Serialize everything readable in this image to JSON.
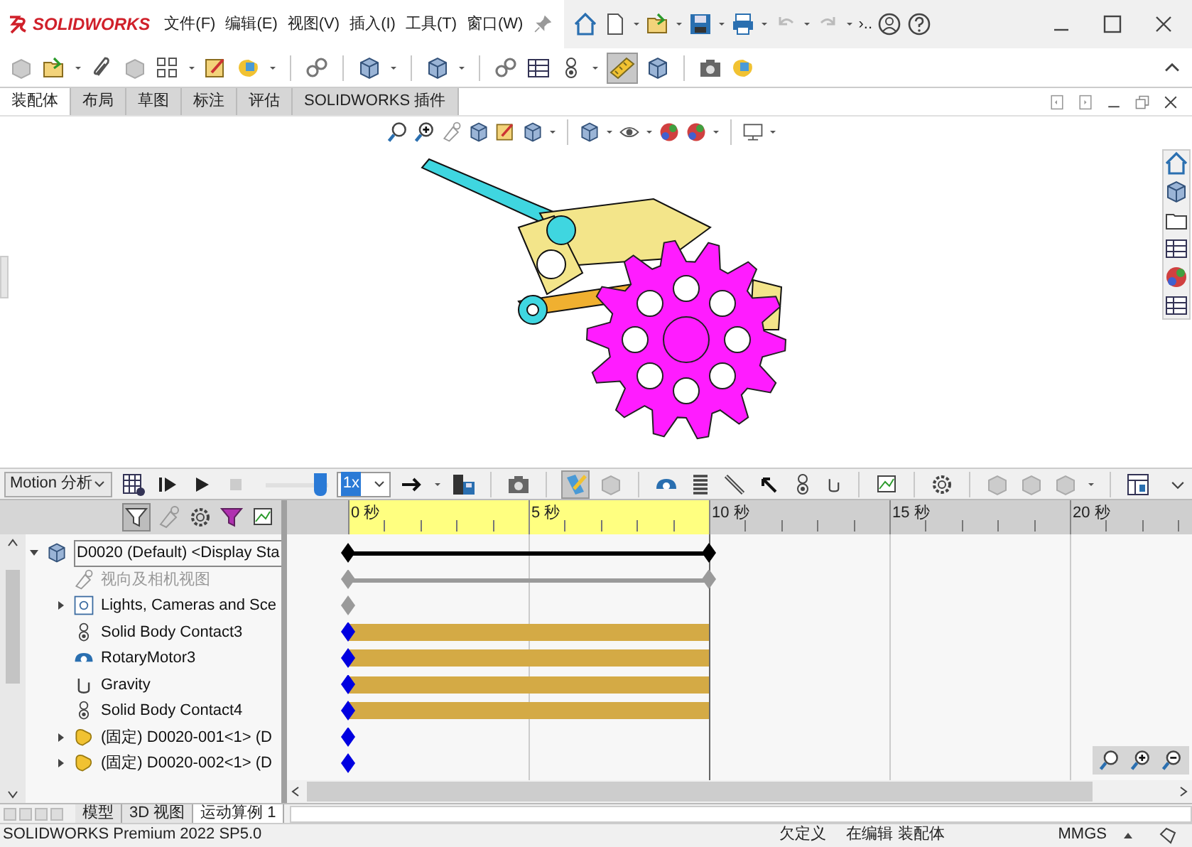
{
  "app": {
    "logo": "SOLIDWORKS",
    "menus": [
      "文件(F)",
      "编辑(E)",
      "视图(V)",
      "插入(I)",
      "工具(T)",
      "窗口(W)"
    ],
    "overflow": "›.."
  },
  "command_tabs": [
    {
      "label": "装配体",
      "selected": true
    },
    {
      "label": "布局",
      "selected": false
    },
    {
      "label": "草图",
      "selected": false
    },
    {
      "label": "标注",
      "selected": false
    },
    {
      "label": "评估",
      "selected": false
    },
    {
      "label": "SOLIDWORKS 插件",
      "selected": false
    }
  ],
  "motion_toolbar": {
    "study_type": "Motion 分析",
    "playback": {
      "level": 0.96
    },
    "speed": "1x"
  },
  "tree": [
    {
      "label": "D0020 (Default) <Display Sta",
      "kind": "assembly",
      "expanded": true,
      "disabled": false
    },
    {
      "label": "视向及相机视图",
      "kind": "camera",
      "disabled": true
    },
    {
      "label": "Lights, Cameras and Sce",
      "kind": "scene",
      "expanded": false,
      "disabled": false
    },
    {
      "label": "Solid Body Contact3",
      "kind": "contact",
      "disabled": false
    },
    {
      "label": "RotaryMotor3",
      "kind": "motor",
      "disabled": false
    },
    {
      "label": "Gravity",
      "kind": "gravity",
      "disabled": false
    },
    {
      "label": "Solid Body Contact4",
      "kind": "contact",
      "disabled": false
    },
    {
      "label": "(固定) D0020-001<1> (D",
      "kind": "part",
      "expanded": false,
      "disabled": false
    },
    {
      "label": "(固定) D0020-002<1> (D",
      "kind": "part",
      "expanded": false,
      "disabled": false
    }
  ],
  "timeline": {
    "ticks": [
      {
        "label": "0 秒",
        "in_range": true
      },
      {
        "label": "5 秒",
        "in_range": true
      },
      {
        "label": "10 秒",
        "in_range": false
      },
      {
        "label": "15 秒",
        "in_range": false
      },
      {
        "label": "20 秒",
        "in_range": false
      }
    ],
    "rows": [
      {
        "kind": "line",
        "color": "#000000"
      },
      {
        "kind": "line",
        "color": "#9a9a9a"
      },
      {
        "kind": "key",
        "color": "#9a9a9a"
      },
      {
        "kind": "bar",
        "color": "#0000e0"
      },
      {
        "kind": "bar",
        "color": "#0000e0"
      },
      {
        "kind": "bar",
        "color": "#0000e0"
      },
      {
        "kind": "bar",
        "color": "#0000e0"
      },
      {
        "kind": "key",
        "color": "#0000e0"
      },
      {
        "kind": "key",
        "color": "#0000e0"
      }
    ]
  },
  "bottom_tabs": [
    {
      "label": "模型",
      "selected": false
    },
    {
      "label": "3D 视图",
      "selected": false
    },
    {
      "label": "运动算例 1",
      "selected": true
    }
  ],
  "status_bar": {
    "product": "SOLIDWORKS Premium 2022 SP5.0",
    "definition": "欠定义",
    "mode": "在编辑 装配体",
    "units": "MMGS"
  }
}
